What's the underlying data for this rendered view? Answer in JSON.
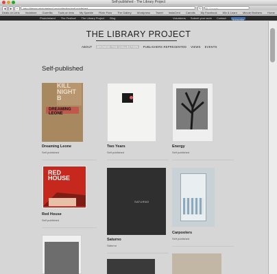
{
  "window": {
    "title": "Self-published - The Library Project"
  },
  "toolbar": {
    "url": "http://library.photoireland.org/collection/self-published",
    "search_placeholder": "Google"
  },
  "bookmarks": [
    "Deals on Lens",
    "Vodafone",
    "Guerrilla",
    "Tools on lens",
    "My Sparkle",
    "Flickr Flow",
    "The Gallery",
    "Wordpress",
    "Tweet",
    "InstaCent",
    "Carrolls",
    "My Facebook",
    "Mix & Learn",
    "Minute Brothers",
    "Home"
  ],
  "sitebar": {
    "links": [
      "PhotoIreland",
      "The Festival",
      "The Library Project",
      "Blog"
    ],
    "right": [
      "Volunteers",
      "Submit your work",
      "Contact"
    ],
    "subscribe": "Subscribe"
  },
  "site": {
    "logo": "THE LIBRARY PROJECT",
    "menu": [
      "ABOUT",
      "BROWSE THE COLLECTION",
      "PUBLISHERS REPRESENTED",
      "VIEWS",
      "EVENTS"
    ]
  },
  "section_title": "Self-published",
  "books": [
    {
      "title": "Dreaming Leone",
      "subtitle": "Self published",
      "cover_text": "KILL\nNIGHT B\nDREAMING LEONE"
    },
    {
      "title": "Two Years",
      "subtitle": "Self published"
    },
    {
      "title": "Energy",
      "subtitle": "Self published"
    },
    {
      "title": "Red House",
      "subtitle": "Self published",
      "cover_text": "RED\nHOUSE"
    },
    {
      "title": "Saturno",
      "subtitle": "Saturno",
      "cover_text": "SATURNO"
    },
    {
      "title": "Carpoolers",
      "subtitle": "Self published"
    }
  ],
  "colors": {
    "page_bg": "#d6d6d6",
    "sitebar_bg": "#2b2b2b",
    "accent": "#3d6fb4"
  }
}
